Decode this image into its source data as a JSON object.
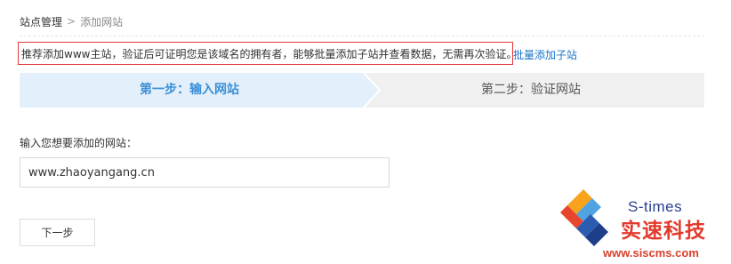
{
  "breadcrumb": {
    "root": "站点管理",
    "separator": ">",
    "current": "添加网站"
  },
  "notice": {
    "text": "推荐添加www主站，验证后可证明您是该域名的拥有者，能够批量添加子站并查看数据，无需再次验证。",
    "link_text": "批量添加子站"
  },
  "steps": [
    {
      "label": "第一步：输入网站",
      "active": true
    },
    {
      "label": "第二步：验证网站",
      "active": false
    }
  ],
  "form": {
    "site_label": "输入您想要添加的网站：",
    "site_value": "www.zhaoyangang.cn",
    "next_label": "下一步"
  },
  "watermark": {
    "brand": "S-times",
    "cn_text": "实速科技",
    "url": "www.siscms.com"
  },
  "colors": {
    "active_step_bg": "#e3f0fb",
    "active_step_text": "#3a8fd7",
    "inactive_step_bg": "#f0f0f0",
    "notice_border": "#e4393c",
    "link": "#1a73c9"
  }
}
